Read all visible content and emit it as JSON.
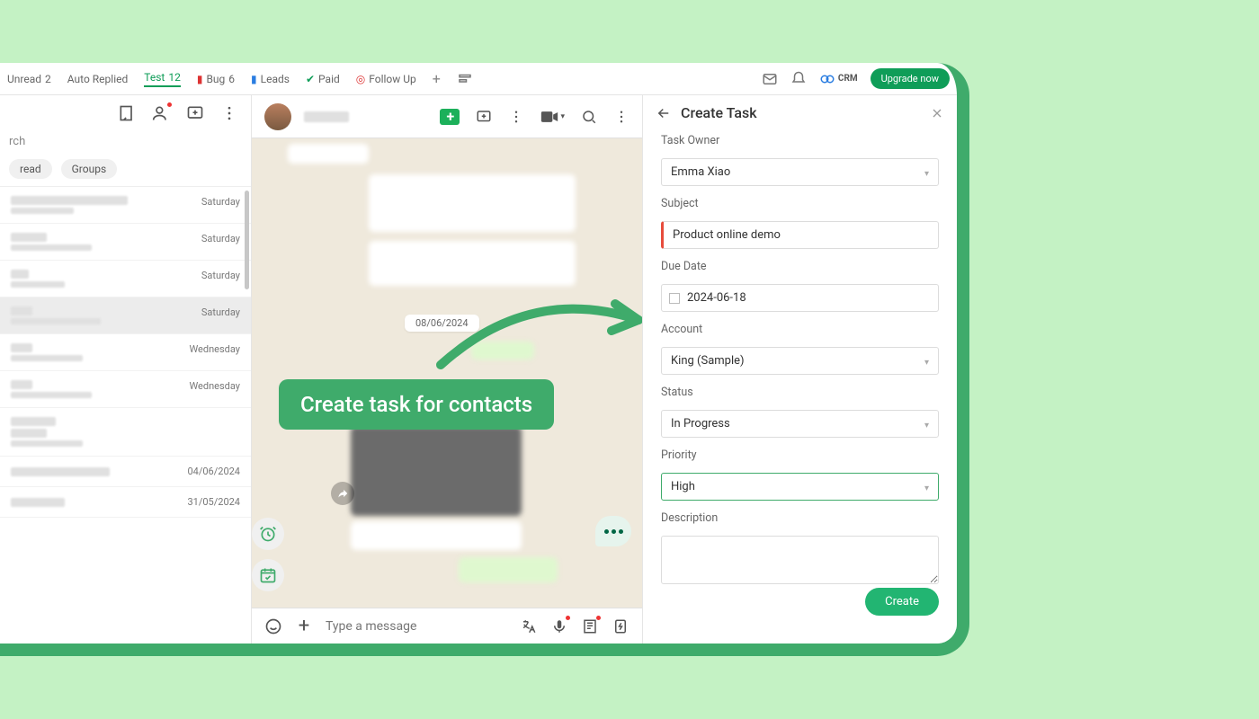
{
  "topbar": {
    "tabs": [
      {
        "label": "Unread",
        "badge": "2"
      },
      {
        "label": "Auto Replied"
      },
      {
        "label": "Test",
        "badge": "12",
        "active": true
      },
      {
        "label": "Bug",
        "badge": "6",
        "dot": "red"
      },
      {
        "label": "Leads",
        "dot": "blue"
      },
      {
        "label": "Paid",
        "dot": "green"
      },
      {
        "label": "Follow Up",
        "dot": "target"
      }
    ],
    "crm": "CRM",
    "upgrade": "Upgrade now"
  },
  "left": {
    "search": "rch",
    "pills": [
      "read",
      "Groups"
    ],
    "dates": [
      "Saturday",
      "Saturday",
      "Saturday",
      "Saturday",
      "Wednesday",
      "Wednesday",
      "",
      "04/06/2024",
      "31/05/2024"
    ]
  },
  "center": {
    "date": "08/06/2024",
    "compose_placeholder": "Type a message"
  },
  "callout": "Create task for contacts",
  "panel": {
    "title": "Create Task",
    "fields": {
      "owner": {
        "label": "Task Owner",
        "value": "Emma Xiao"
      },
      "subject": {
        "label": "Subject",
        "value": "Product online demo"
      },
      "due": {
        "label": "Due Date",
        "value": "2024-06-18"
      },
      "account": {
        "label": "Account",
        "value": "King (Sample)"
      },
      "status": {
        "label": "Status",
        "value": "In Progress"
      },
      "priority": {
        "label": "Priority",
        "value": "High"
      },
      "description": {
        "label": "Description",
        "value": ""
      }
    },
    "submit": "Create"
  }
}
